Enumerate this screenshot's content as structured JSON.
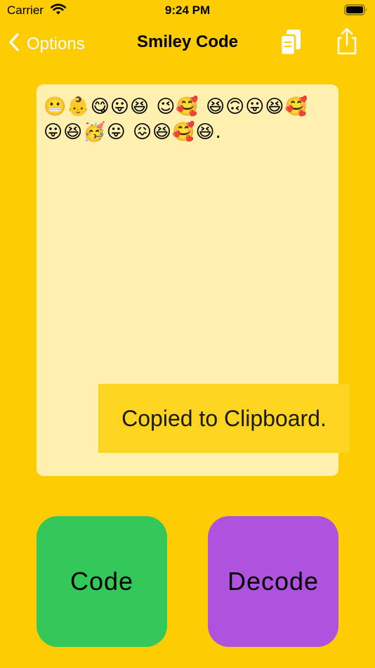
{
  "status_bar": {
    "carrier": "Carrier",
    "time": "9:24 PM",
    "icons": [
      "wifi-icon",
      "battery-icon"
    ]
  },
  "nav": {
    "back_label": "Options",
    "title": "Smiley Code",
    "icons": [
      "chevron-left-icon",
      "copy-icon",
      "share-icon"
    ]
  },
  "editor": {
    "text": "😬👶😋😛😆 😉🥰 😆🙃😛😆🥰 😛😆🥳😛 😖😆🥰😆."
  },
  "toast": {
    "message": "Copied to Clipboard."
  },
  "actions": {
    "code_label": "Code",
    "decode_label": "Decode"
  },
  "colors": {
    "background": "#FECC02",
    "panel": "#FFF0B0",
    "toast": "#FDD420",
    "code_button": "#34C759",
    "decode_button": "#AF52DE",
    "nav_tint": "#FFFFFF"
  }
}
